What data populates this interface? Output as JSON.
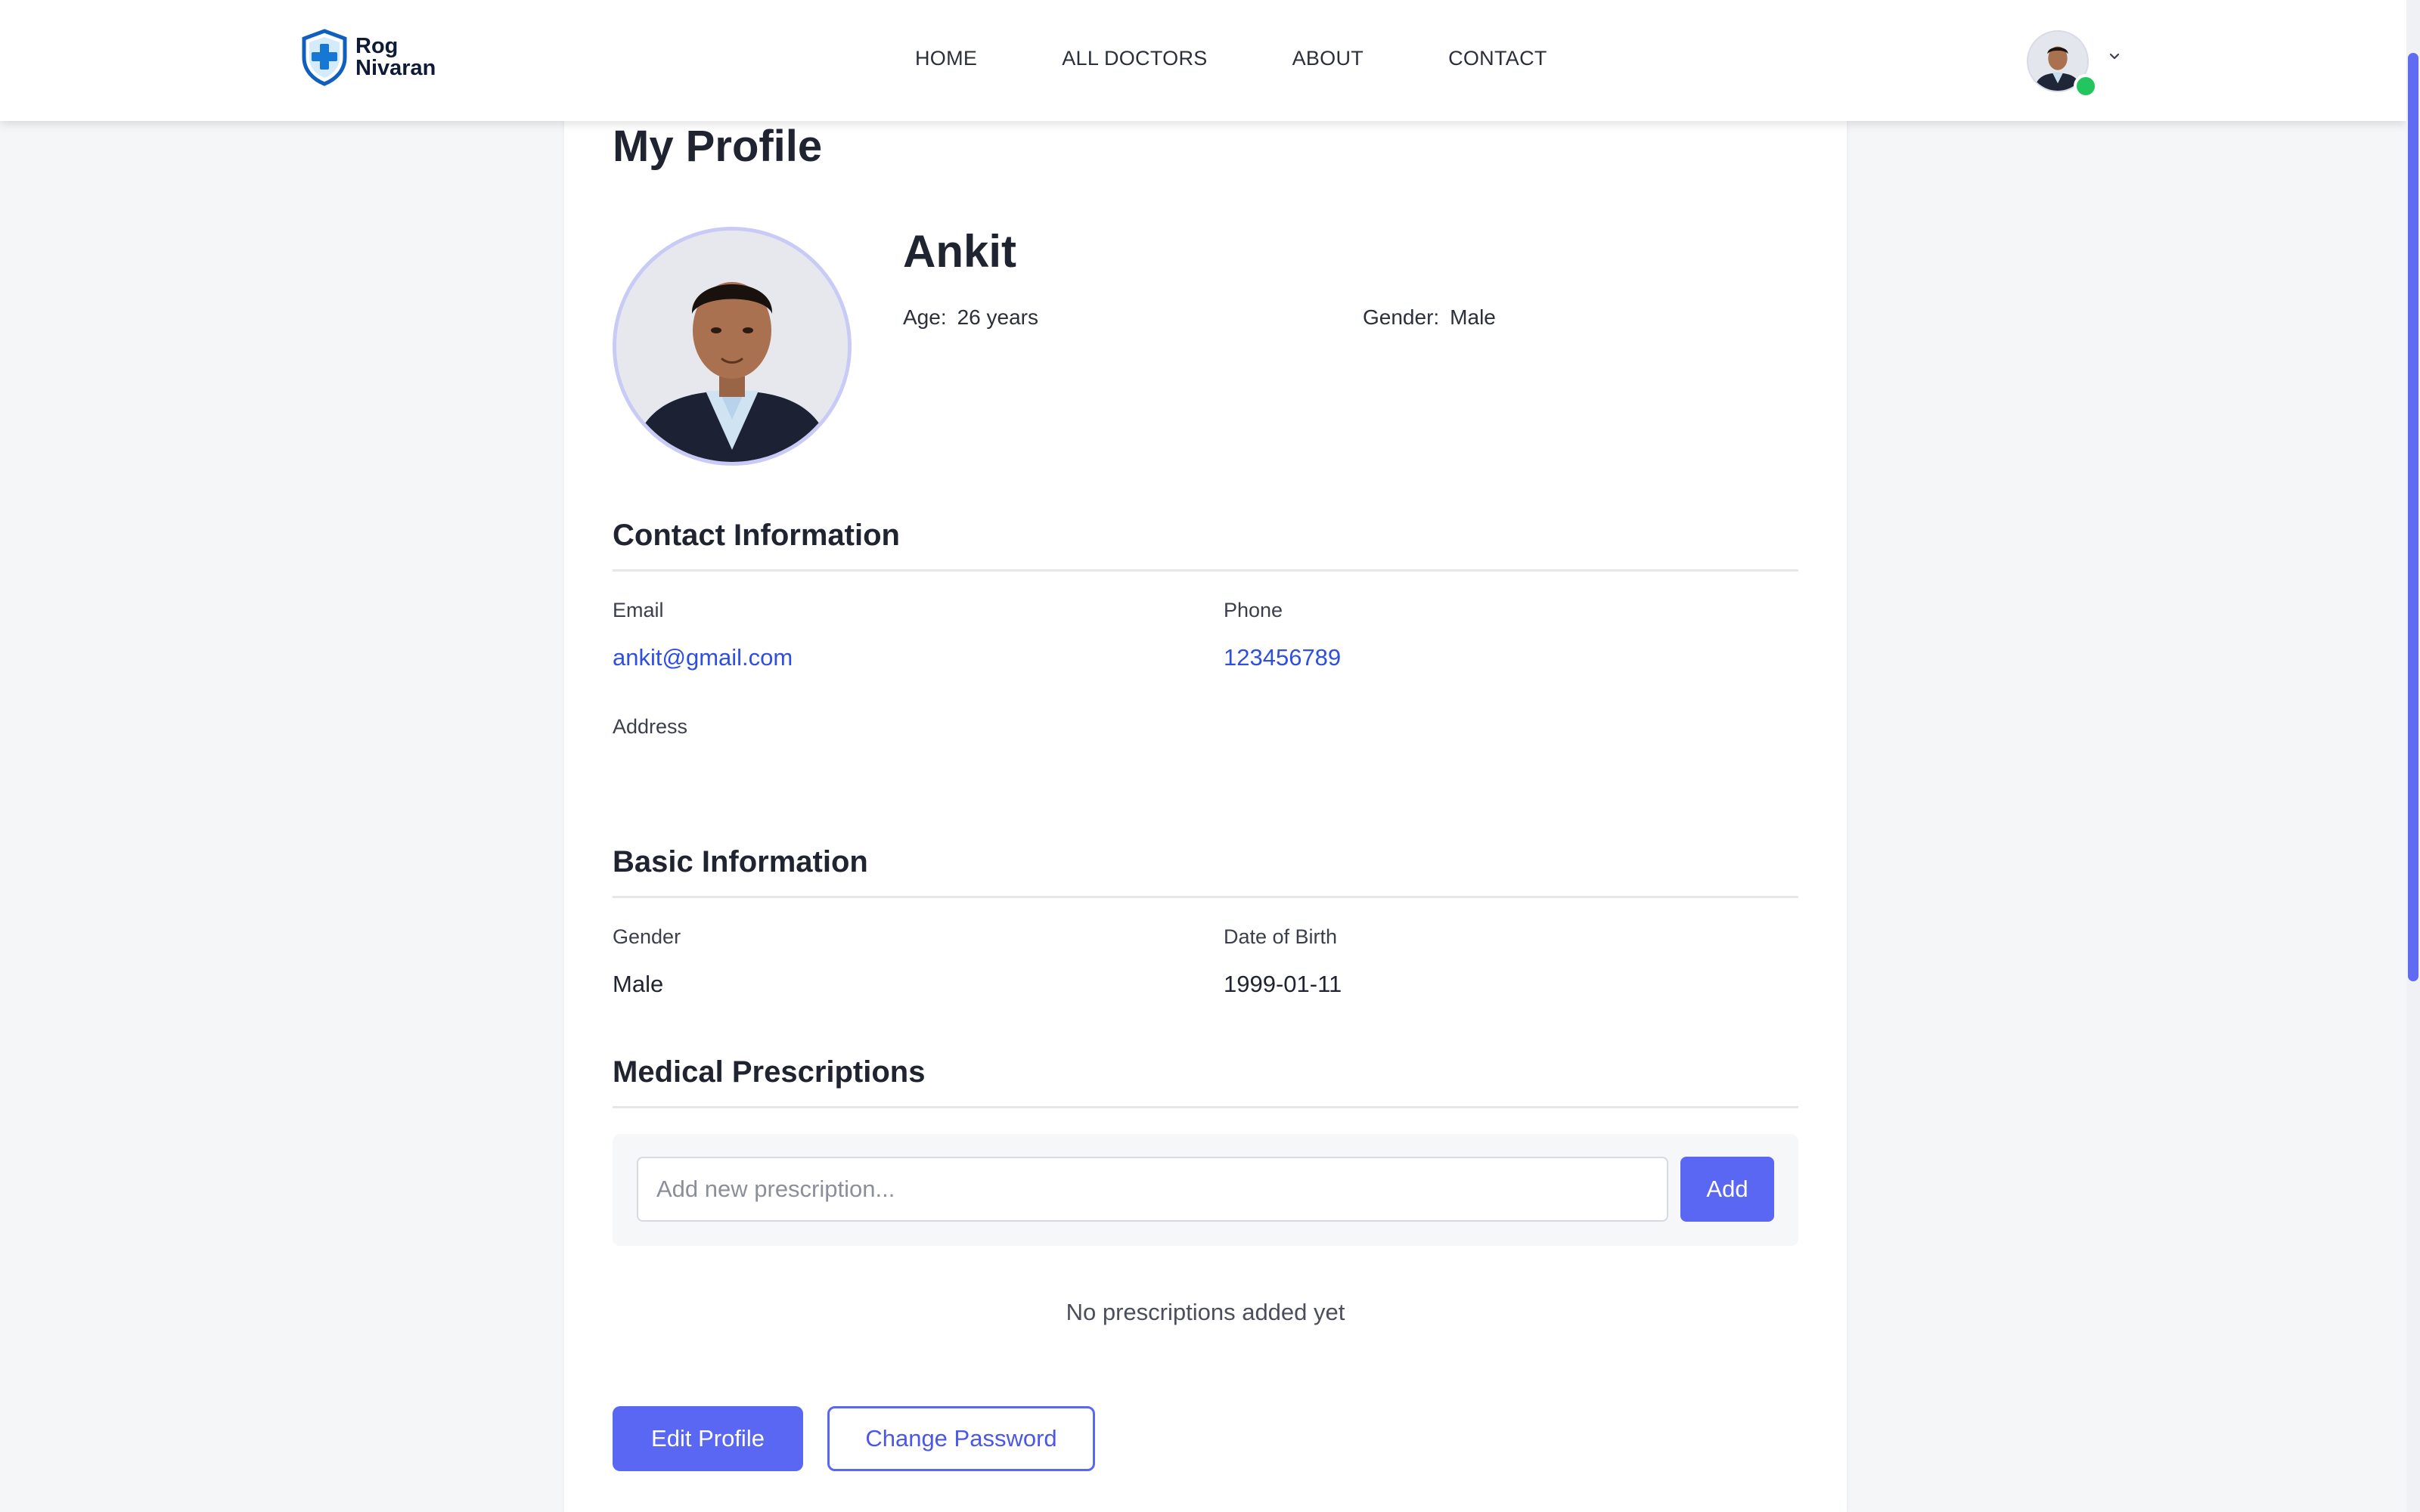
{
  "brand": {
    "line1": "Rog",
    "line2": "Nivaran",
    "color": "#0f5fbf"
  },
  "nav": {
    "items": [
      "HOME",
      "ALL DOCTORS",
      "ABOUT",
      "CONTACT"
    ]
  },
  "user_menu": {
    "status": "online",
    "status_color": "#22c55e"
  },
  "page": {
    "title": "My Profile"
  },
  "profile": {
    "name": "Ankit",
    "age_label": "Age:",
    "age_value": "26 years",
    "gender_label": "Gender:",
    "gender_value": "Male"
  },
  "contact": {
    "title": "Contact Information",
    "email_label": "Email",
    "email_value": "ankit@gmail.com",
    "phone_label": "Phone",
    "phone_value": "123456789",
    "address_label": "Address",
    "address_value": ""
  },
  "basic": {
    "title": "Basic Information",
    "gender_label": "Gender",
    "gender_value": "Male",
    "dob_label": "Date of Birth",
    "dob_value": "1999-01-11"
  },
  "prescriptions": {
    "title": "Medical Prescriptions",
    "placeholder": "Add new prescription...",
    "add_label": "Add",
    "empty_text": "No prescriptions added yet"
  },
  "actions": {
    "edit_label": "Edit Profile",
    "change_password_label": "Change Password"
  },
  "colors": {
    "accent": "#5a67f2",
    "link": "#2f4fe0",
    "page_bg": "#f5f6f8"
  }
}
